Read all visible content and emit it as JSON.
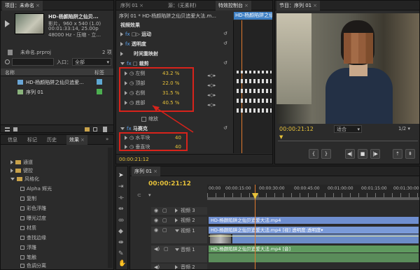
{
  "project_panel": {
    "tab": "项目：未命名",
    "clip_name": "HD-杨颜陷阱之仙贝...",
    "clip_info_1": "影片，960 x 540 (1.0)",
    "clip_info_2": "00:01:33:14, 25.00p",
    "clip_info_3": "48000 Hz - 压缩 - 立...",
    "project_file": "未命名.prproj",
    "item_count": "2 项",
    "entry_label": "入口：",
    "entry_value": "全部",
    "col_name": "名称",
    "col_tag": "标签",
    "items": [
      {
        "name": "HD-杨颜陷阱之仙贝追爱...",
        "tag_color": "#5fa8d3"
      },
      {
        "name": "序列 01",
        "tag_color": "#4caf50"
      }
    ]
  },
  "effects_panel": {
    "tabs": [
      "信息",
      "标记",
      "历史",
      "效果"
    ],
    "items": [
      "通道",
      "键控",
      "风格化",
      "Alpha 辉光",
      "复制",
      "彩色浮雕",
      "曝光过度",
      "材质",
      "查找边缘",
      "浮雕",
      "笔触",
      "色调分离"
    ]
  },
  "effect_controls": {
    "tabs": [
      "序列 01",
      "源：(无素材)",
      "特效控制台"
    ],
    "breadcrumb": "序列 01 * HD-杨颜陷阱之仙贝追爱大法.m...",
    "clip_label": "HD-杨颜陷阱之仙贝",
    "section": "视频效果",
    "motion": "运动",
    "opacity": "透明度",
    "time_remap": "时间重映射",
    "crop": "裁剪",
    "crop_params": [
      {
        "label": "左侧",
        "value": "43.2 %"
      },
      {
        "label": "顶部",
        "value": "22.0 %"
      },
      {
        "label": "右侧",
        "value": "31.5 %"
      },
      {
        "label": "底部",
        "value": "40.5 %"
      }
    ],
    "zoom": "缩放",
    "mosaic": "马赛克",
    "mosaic_params": [
      {
        "label": "水平块",
        "value": "40"
      },
      {
        "label": "垂直块",
        "value": "40"
      }
    ],
    "timecode": "00:00:21:12"
  },
  "program_monitor": {
    "tab": "节目：序列 01",
    "timecode": "00:00:21:12",
    "fit": "适合",
    "ratio": "1/2"
  },
  "timeline": {
    "tab": "序列 01",
    "timecode": "00:00:21:12",
    "ruler": [
      "00:00",
      "00:00:15:00",
      "00:00:30:00",
      "00:00:45:00",
      "00:01:00:00",
      "00:01:15:00",
      "00:01:30:00",
      "00:01:45:00"
    ],
    "tracks": [
      "视频 3",
      "视频 2",
      "视频 1",
      "音频 1",
      "音频 2"
    ],
    "clips": {
      "v2": "HD-杨颜陷阱之仙贝追爱大法.mp4",
      "v1": "HD-杨颜陷阱之仙贝追爱大法.mp4 [视]  透明度:透明度▾",
      "a1": "HD-杨颜陷阱之仙贝追爱大法.mp4 [音]"
    }
  }
}
